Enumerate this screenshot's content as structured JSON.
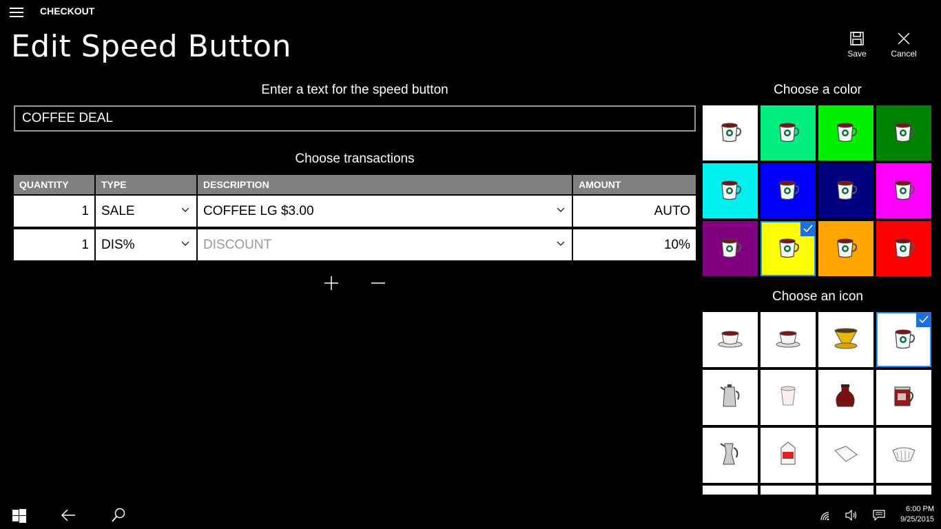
{
  "app": {
    "title": "CHECKOUT"
  },
  "page": {
    "title": "Edit Speed Button"
  },
  "commands": {
    "save_label": "Save",
    "cancel_label": "Cancel"
  },
  "text_section": {
    "heading": "Enter a text for the speed button",
    "value": "COFFEE DEAL"
  },
  "transactions": {
    "heading": "Choose transactions",
    "columns": [
      "QUANTITY",
      "TYPE",
      "DESCRIPTION",
      "AMOUNT"
    ],
    "rows": [
      {
        "quantity": "1",
        "type": "SALE",
        "description": "COFFEE LG $3.00",
        "description_is_placeholder": false,
        "amount": "AUTO"
      },
      {
        "quantity": "1",
        "type": "DIS%",
        "description": "DISCOUNT",
        "description_is_placeholder": true,
        "amount": "10%"
      }
    ]
  },
  "color_section": {
    "heading": "Choose a color",
    "colors": [
      "#ffffff",
      "#00f080",
      "#00f000",
      "#008000",
      "#00f0f0",
      "#0000ff",
      "#000080",
      "#ff00ff",
      "#800080",
      "#ffff00",
      "#ffa500",
      "#ff0000"
    ],
    "selected_index": 9
  },
  "icon_section": {
    "heading": "Choose an icon",
    "icons": [
      "cup-saucer-icon",
      "cup-saucer-icon",
      "filter-holder-icon",
      "mug-icon",
      "coffee-pot-icon",
      "cup-icon",
      "carafe-icon",
      "coffee-maker-icon",
      "espresso-pot-icon",
      "milk-carton-icon",
      "coffee-filter-icon",
      "paper-filter-icon"
    ],
    "selected_index": 3
  },
  "taskbar": {
    "time": "6:00 PM",
    "date": "9/25/2015"
  }
}
